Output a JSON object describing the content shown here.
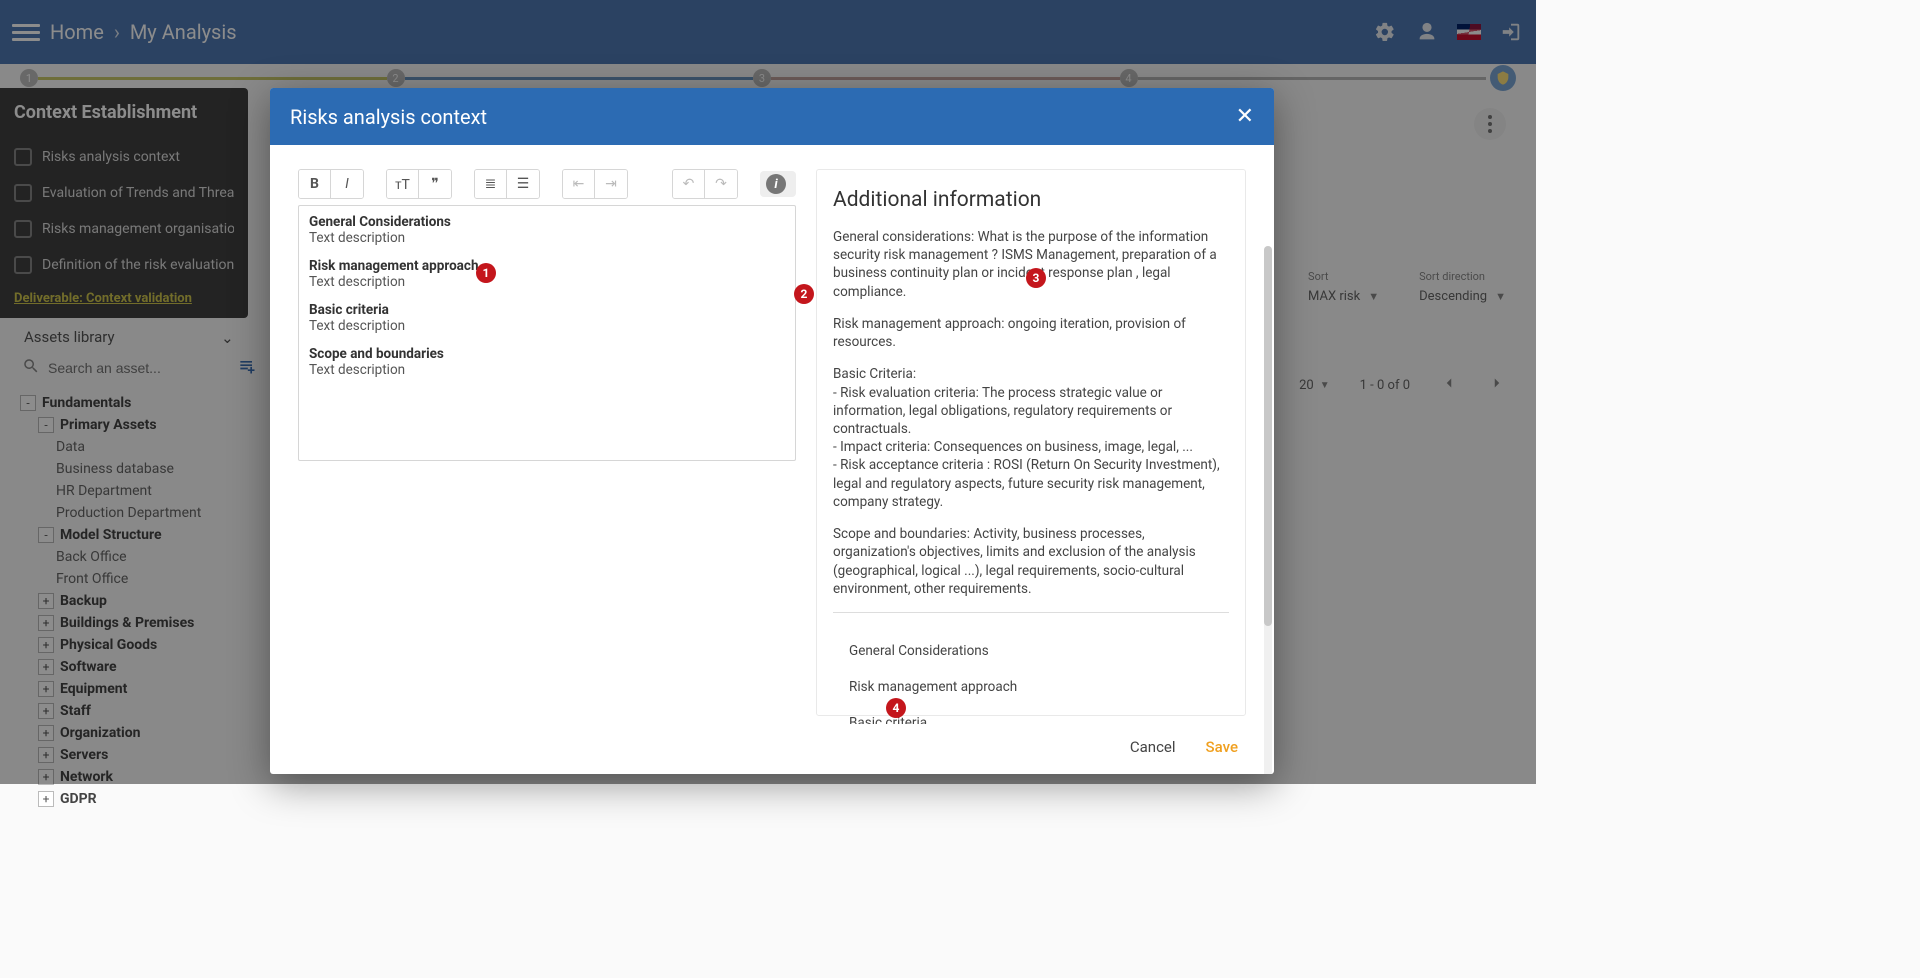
{
  "breadcrumb": {
    "home": "Home",
    "current": "My Analysis"
  },
  "stepper": {
    "n1": "1",
    "n2": "2",
    "n3": "3",
    "n4": "4"
  },
  "context_panel": {
    "title": "Context Establishment",
    "items": [
      "Risks analysis context",
      "Evaluation of Trends and Threat, and synthesis",
      "Risks management organisation",
      "Definition of the risk evaluation criteria"
    ],
    "deliverable": "Deliverable: Context validation"
  },
  "assets": {
    "title": "Assets library",
    "search_placeholder": "Search an asset...",
    "tree": {
      "root": "Fundamentals",
      "primary": "Primary Assets",
      "primary_children": [
        "Data",
        "Business database",
        "HR Department",
        "Production Department"
      ],
      "model": "Model Structure",
      "model_children": [
        "Back Office",
        "Front Office"
      ],
      "collapsed": [
        "Backup",
        "Buildings & Premises",
        "Physical Goods",
        "Software",
        "Equipment",
        "Staff",
        "Organization",
        "Servers",
        "Network",
        "GDPR"
      ]
    }
  },
  "filters": {
    "sort_label": "Sort",
    "sort_value": "MAX risk",
    "dir_label": "Sort direction",
    "dir_value": "Descending"
  },
  "pager": {
    "page_size": "20",
    "range": "1 - 0 of 0"
  },
  "modal": {
    "title": "Risks analysis context",
    "editor_sections": [
      {
        "title": "General Considerations",
        "body": "Text description"
      },
      {
        "title": "Risk management approach",
        "body": "Text description"
      },
      {
        "title": "Basic criteria",
        "body": "Text description"
      },
      {
        "title": "Scope and boundaries",
        "body": "Text description"
      }
    ],
    "info_title": "Additional information",
    "info_p1": "General considerations: What is the purpose of the information security risk management ? ISMS Management, preparation of a business continuity plan or incident response plan , legal compliance.",
    "info_p2": "Risk management approach: ongoing iteration, provision of resources.",
    "info_p3": "Basic Criteria:\n- Risk evaluation criteria: The process strategic value or information, legal obligations, regulatory requirements or contractuals.\n- Impact criteria:  Consequences on business, image, legal, ...\n- Risk acceptance criteria : ROSI (Return On Security Investment), legal and regulatory aspects, future security risk management, company strategy.",
    "info_p4": "Scope and boundaries: Activity, business processes, organization's objectives,  limits and exclusion of the analysis (geographical, logical ...), legal requirements, socio-cultural environment, other requirements.",
    "links": [
      "General Considerations",
      "Risk management approach",
      "Basic criteria"
    ],
    "cancel": "Cancel",
    "save": "Save"
  },
  "callouts": {
    "c1": "1",
    "c2": "2",
    "c3": "3",
    "c4": "4"
  }
}
